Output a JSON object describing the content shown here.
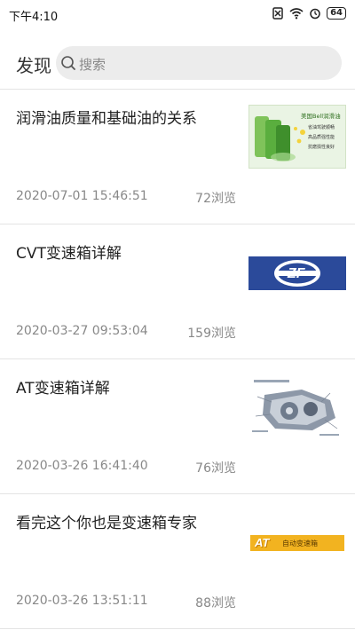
{
  "status_bar": {
    "time": "下午4:10",
    "battery": "64",
    "icons": [
      "sim-off-icon",
      "wifi-icon",
      "alarm-icon",
      "battery-icon"
    ]
  },
  "header": {
    "title": "发现",
    "search_placeholder": "搜索"
  },
  "articles": [
    {
      "title": "润滑油质量和基础油的关系",
      "date": "2020-07-01 15:46:51",
      "views": "72浏览",
      "thumb_text": "美国Bell润滑油",
      "thumb_bullets": [
        "省油驾驶顺畅",
        "高品质强性能",
        "抗磨损性良好"
      ]
    },
    {
      "title": "CVT变速箱详解",
      "date": "2020-03-27 09:53:04",
      "views": "159浏览",
      "thumb_text": "ZF"
    },
    {
      "title": "AT变速箱详解",
      "date": "2020-03-26 16:41:40",
      "views": "76浏览",
      "thumb_text": ""
    },
    {
      "title": "看完这个你也是变速箱专家",
      "date": "2020-03-26 13:51:11",
      "views": "88浏览",
      "thumb_text": "AT",
      "thumb_subtext": "自动变速箱"
    }
  ],
  "colors": {
    "divider": "#e4e4e4",
    "search_bg": "#ececec",
    "meta_text": "#888888",
    "zf_blue": "#2b4a9a",
    "at_yellow": "#f2b320"
  }
}
